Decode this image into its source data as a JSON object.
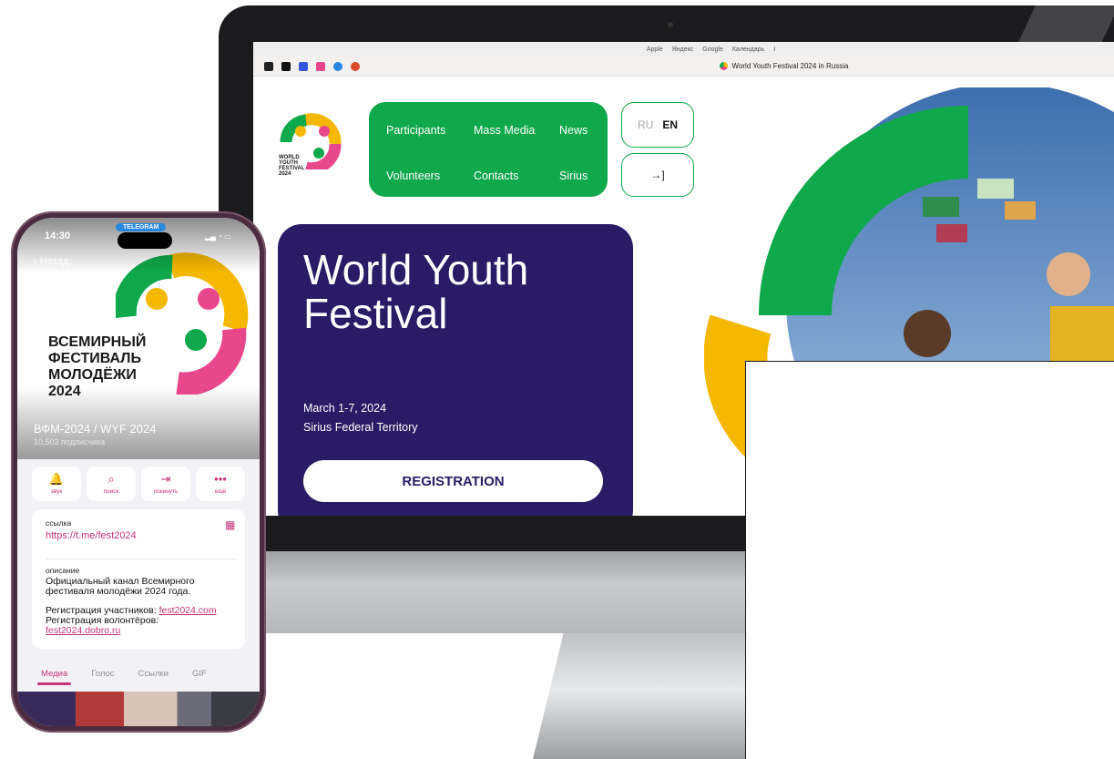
{
  "browser": {
    "bookmarks": [
      "Apple",
      "Яндекс",
      "Google",
      "Календарь",
      "I"
    ],
    "tab_title": "World Youth Festival 2024 in Russia"
  },
  "site": {
    "logo_text": "WORLD\nYOUTH\nFESTIVAL\n2024",
    "nav": [
      "Participants",
      "Mass Media",
      "News",
      "Volunteers",
      "Contacts",
      "Sirius"
    ],
    "lang_ru": "RU",
    "lang_en": "EN",
    "login_icon": "→]",
    "hero_title": "World Youth Festival",
    "hero_date": "March 1-7, 2024",
    "hero_place": "Sirius Federal Territory",
    "registration": "REGISTRATION"
  },
  "phone": {
    "time": "14:30",
    "status_pill": "TELEGRAM",
    "back": "Назад",
    "festival_title_ru": [
      "ВСЕМИРНЫЙ",
      "ФЕСТИВАЛЬ",
      "МОЛОДЁЖИ",
      "2024"
    ],
    "channel_name": "ВФМ-2024 / WYF 2024",
    "subscribers": "10,503 подписчика",
    "actions": [
      {
        "icon": "bell-icon",
        "glyph": "🔔",
        "label": "звук"
      },
      {
        "icon": "search-icon",
        "glyph": "⌕",
        "label": "поиск"
      },
      {
        "icon": "leave-icon",
        "glyph": "⇥",
        "label": "покинуть"
      },
      {
        "icon": "more-icon",
        "glyph": "•••",
        "label": "ещё"
      }
    ],
    "link_label": "ссылка",
    "link": "https://t.me/fest2024",
    "desc_label": "описание",
    "desc": "Официальный канал Всемирного фестиваля молодёжи 2024 года.",
    "reg_participants_label": "Регистрация участников:",
    "reg_participants_link": "fest2024.com",
    "reg_volunteers_label": "Регистрация волонтёров:",
    "reg_volunteers_link": "fest2024.dobro.ru",
    "tabs": [
      "Медиа",
      "Голос",
      "Ссылки",
      "GIF"
    ]
  },
  "colors": {
    "green": "#0fa84a",
    "yellow": "#f5b800",
    "pink": "#e8478b",
    "purple": "#2a1b66",
    "telegram_accent": "#c7357a"
  }
}
